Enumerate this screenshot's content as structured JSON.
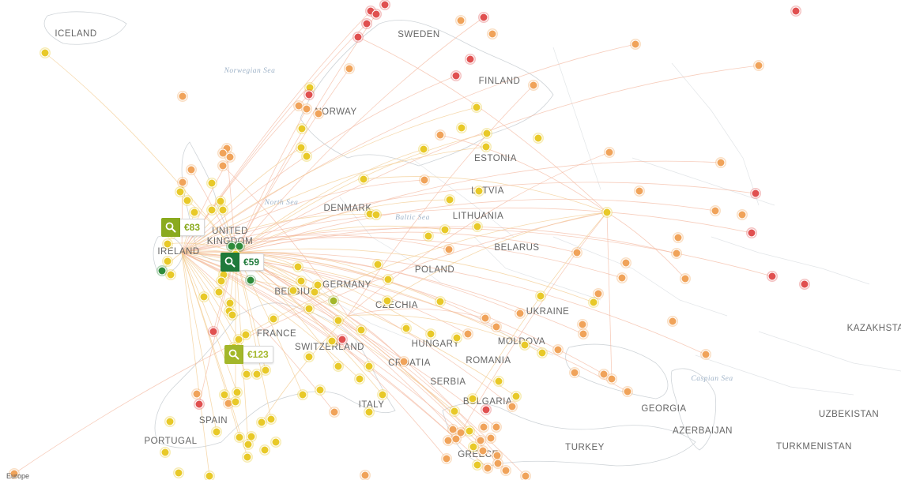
{
  "map": {
    "attribution": "Europe",
    "country_labels": [
      "ICELAND",
      "SWEDEN",
      "FINLAND",
      "NORWAY",
      "ESTONIA",
      "LATVIA",
      "LITHUANIA",
      "DENMARK",
      "UNITED KINGDOM",
      "IRELAND",
      "BELARUS",
      "POLAND",
      "GERMANY",
      "BELGIUM",
      "CZECHIA",
      "UKRAINE",
      "FRANCE",
      "SWITZERLAND",
      "HUNGARY",
      "MOLDOVA",
      "ROMANIA",
      "CROATIA",
      "SERBIA",
      "BULGARIA",
      "ITALY",
      "SPAIN",
      "PORTUGAL",
      "GREECE",
      "TURKEY",
      "GEORGIA",
      "AZERBAIJAN",
      "KAZAKHSTAN",
      "UZBEKISTAN",
      "TURKMENISTAN"
    ],
    "sea_labels": [
      "Norwegian Sea",
      "North Sea",
      "Baltic Sea",
      "Caspian Sea"
    ],
    "colors": {
      "cheapest": "#2e8b3a",
      "cheap": "#a3b72a",
      "mid": "#e8c928",
      "pricey": "#f0a35a",
      "expensive": "#e05050",
      "route": "#f2c98a"
    }
  },
  "price_tags": [
    {
      "price": "€83",
      "color": "#8aaa1e",
      "icon": "search-icon"
    },
    {
      "price": "€59",
      "color": "#1f7a3b",
      "icon": "search-icon"
    },
    {
      "price": "€123",
      "color": "#a3b72a",
      "icon": "search-icon"
    }
  ]
}
